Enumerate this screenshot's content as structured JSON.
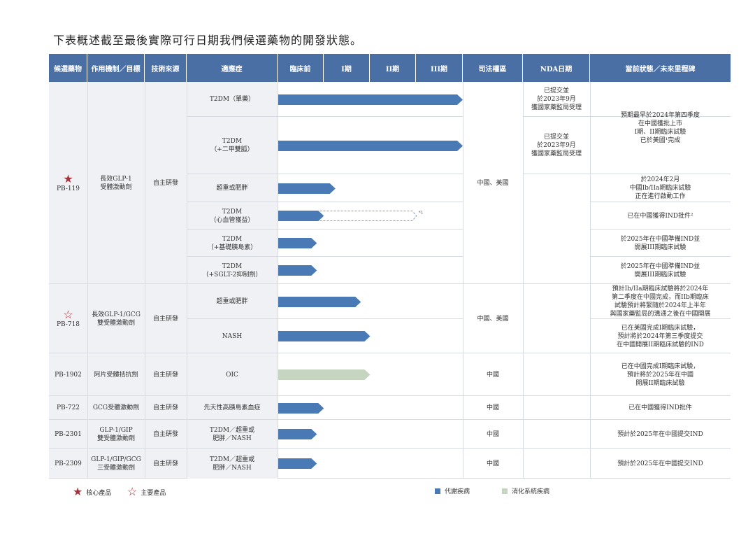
{
  "intro": "下表概述截至最後實際可行日期我們候選藥物的開發狀態。",
  "headers": {
    "candidate": "候選藥物",
    "mechanism": "作用機制／目標",
    "source": "技術來源",
    "indication": "適應症",
    "preclinical": "臨床前",
    "phase1": "I期",
    "phase2": "II期",
    "phase3": "III期",
    "jurisdiction": "司法權區",
    "nda": "NDA日期",
    "status": "當前狀態／未來里程碑"
  },
  "colors": {
    "header": "#4a6fa5",
    "metabolic": "#4a7ab5",
    "digestive": "#c5d5c0",
    "core_star": "#a8323c",
    "shade": "#eff1f4"
  },
  "drugs": [
    {
      "name": "PB-119",
      "mechanism": "長效GLP-1\n受體激動劑",
      "source": "自主研發",
      "jurisdiction": "中國、美國",
      "star": "core"
    },
    {
      "name": "PB-718",
      "mechanism": "長效GLP-1/GCG\n雙受體激動劑",
      "source": "自主研發",
      "jurisdiction": "中國、美國",
      "star": "key"
    },
    {
      "name": "PB-1902",
      "mechanism": "阿片受體拮抗劑",
      "source": "自主研發",
      "jurisdiction": "中國"
    },
    {
      "name": "PB-722",
      "mechanism": "GCG受體激動劑",
      "source": "自主研發",
      "jurisdiction": "中國"
    },
    {
      "name": "PB-2301",
      "mechanism": "GLP-1/GIP\n雙受體激動劑",
      "source": "自主研發",
      "jurisdiction": "中國"
    },
    {
      "name": "PB-2309",
      "mechanism": "GLP-1/GIP/GCG\n三受體激動劑",
      "source": "自主研發",
      "jurisdiction": "中國"
    }
  ],
  "rows": [
    {
      "indication": "T2DM（單藥）",
      "stage": 4.0,
      "category": "metabolic",
      "nda": "已提交並\n於2023年9月\n獲國家藥監局受理"
    },
    {
      "indication": "T2DM\n（+二甲雙胍）",
      "stage": 4.0,
      "category": "metabolic",
      "nda": "已提交並\n於2023年9月\n獲國家藥監局受理"
    },
    {
      "indication": "超重或肥胖",
      "stage": 1.25,
      "category": "metabolic",
      "status": "於2024年2月\n中國Ib/IIa期臨床試驗\n正在進行啟動工作"
    },
    {
      "indication": "T2DM\n（心血管獲益）",
      "stage": 1.0,
      "category": "metabolic",
      "dashed_to": 3.0,
      "note": "*1",
      "status": "已在中國獲得IND批件²"
    },
    {
      "indication": "T2DM\n（+基礎胰島素）",
      "stage": 0.85,
      "category": "metabolic",
      "status": "於2025年在中國準備IND並\n開展III期臨床試驗"
    },
    {
      "indication": "T2DM\n（+SGLT-2抑制劑）",
      "stage": 0.85,
      "category": "metabolic",
      "status": "於2025年在中國準備IND並\n開展III期臨床試驗"
    },
    {
      "indication": "超重或肥胖",
      "stage": 1.8,
      "category": "metabolic",
      "status": "預計Ib/IIa期臨床試驗將於2024年\n第二季度在中國完成，而IIb期臨床\n試驗預計將緊隨於2024年上半年\n與國家藥監局的溝通之後在中國開展"
    },
    {
      "indication": "NASH",
      "stage": 2.0,
      "category": "metabolic",
      "status": "已在美國完成I期臨床試驗，\n預計將於2024年第三季度提交\n在中國開展II期臨床試驗的IND"
    },
    {
      "indication": "OIC",
      "stage": 2.0,
      "category": "digestive",
      "status": "已在中國完成I期臨床試驗，\n預計將於2025年在中國\n開展II期臨床試驗"
    },
    {
      "indication": "先天性高胰島素血症",
      "stage": 1.0,
      "category": "metabolic",
      "status": "已在中國獲得IND批件"
    },
    {
      "indication": "T2DM／超重或\n肥胖／NASH",
      "stage": 0.85,
      "category": "metabolic",
      "status": "預計於2025年在中國提交IND"
    },
    {
      "indication": "T2DM／超重或\n肥胖／NASH",
      "stage": 0.85,
      "category": "metabolic",
      "status": "預計於2025年在中國提交IND"
    }
  ],
  "pb119_status_top": "預期最早於2024年第四季度\n在中國獲批上市\nI期、II期臨床試驗\n已於美國¹完成",
  "legend": {
    "core": "核心產品",
    "key": "主要產品",
    "metabolic": "代謝疾病",
    "digestive": "消化系統疾病"
  }
}
